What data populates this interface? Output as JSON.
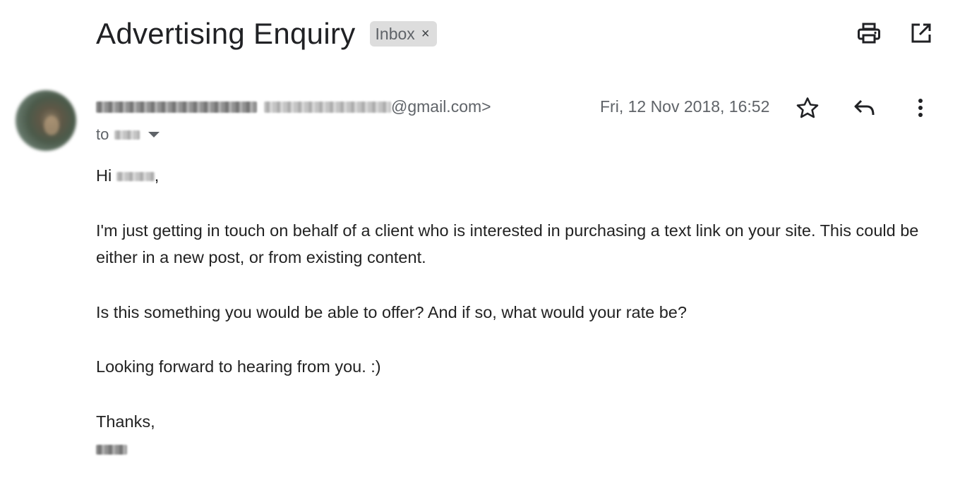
{
  "email": {
    "subject": "Advertising Enquiry",
    "label_chip": "Inbox",
    "label_remove": "×",
    "sender_email_suffix": "@gmail.com>",
    "date": "Fri, 12 Nov 2018, 16:52",
    "to_prefix": "to",
    "body": {
      "greeting_prefix": "Hi",
      "greeting_suffix": ",",
      "paragraph_1": "I'm just getting in touch on behalf of a client who is interested in purchasing a text link on your site. This could be either in a new post, or from existing content.",
      "paragraph_2": "Is this something you would be able to offer? And if so, what would your rate be?",
      "paragraph_3": "Looking forward to hearing from you. :)",
      "signoff": "Thanks,"
    }
  },
  "icons": {
    "print": "print-icon",
    "open_new_window": "open-in-new-window-icon",
    "star": "star-icon",
    "reply": "reply-icon",
    "more": "more-vert-icon",
    "dropdown": "chevron-down-icon"
  },
  "colors": {
    "text_primary": "#202124",
    "text_secondary": "#5f6368",
    "chip_bg": "#dddddd"
  }
}
